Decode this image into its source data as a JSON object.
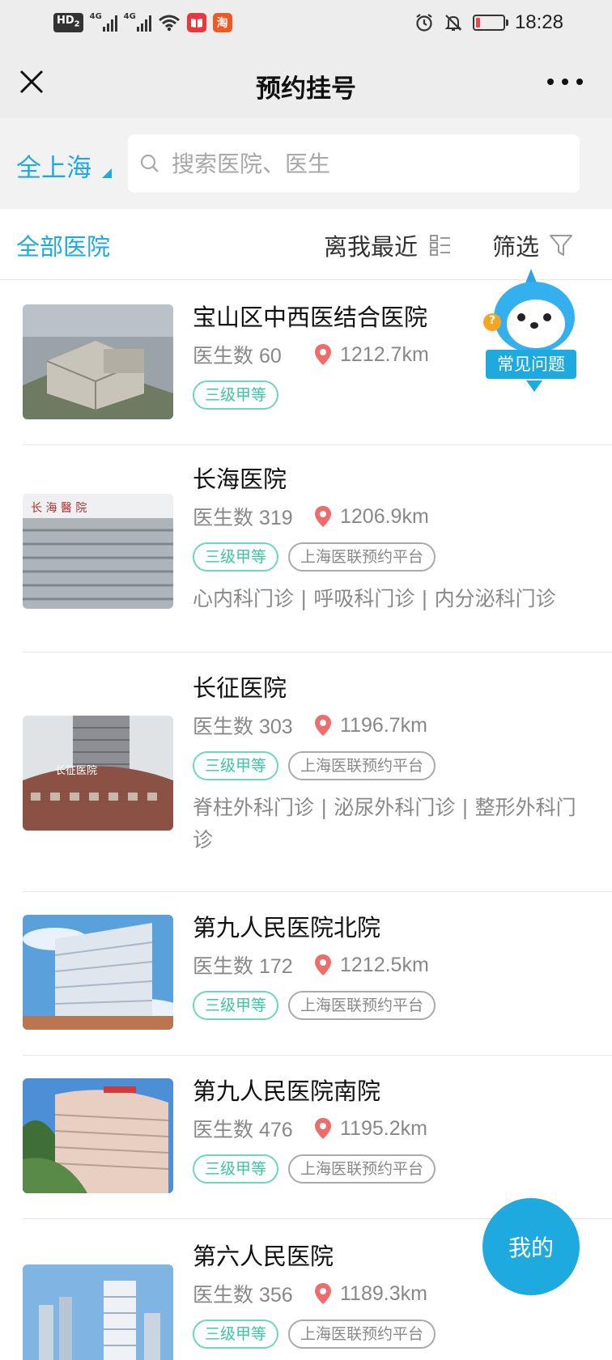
{
  "status_bar": {
    "hd": "HD",
    "hd_sub": "2",
    "net1": "4G",
    "net2": "4G",
    "app1_glyph": "",
    "app2_glyph": "淘",
    "time": "18:28",
    "battery_level": 0.15,
    "icons": [
      "hd-icon",
      "signal-icon",
      "signal-icon",
      "wifi-icon",
      "reader-app-icon",
      "taobao-app-icon",
      "alarm-icon",
      "mute-icon",
      "battery-icon"
    ]
  },
  "nav": {
    "title": "预约挂号",
    "close_icon": "close-icon",
    "more_icon": "more-icon"
  },
  "search": {
    "city": "全上海",
    "placeholder": "搜索医院、医生"
  },
  "filters": {
    "all_hospitals": "全部医院",
    "sort_nearest": "离我最近",
    "filter": "筛选"
  },
  "hospitals": [
    {
      "name": "宝山区中西医结合医院",
      "doctor_count": "医生数 60",
      "distance": "1212.7km",
      "tags": [
        "三级甲等"
      ],
      "depts": ""
    },
    {
      "name": "长海医院",
      "doctor_count": "医生数 319",
      "distance": "1206.9km",
      "tags": [
        "三级甲等",
        "上海医联预约平台"
      ],
      "depts": "心内科门诊 | 呼吸科门诊 | 内分泌科门诊"
    },
    {
      "name": "长征医院",
      "doctor_count": "医生数 303",
      "distance": "1196.7km",
      "tags": [
        "三级甲等",
        "上海医联预约平台"
      ],
      "depts": "脊柱外科门诊 | 泌尿外科门诊 | 整形外科门诊"
    },
    {
      "name": "第九人民医院北院",
      "doctor_count": "医生数 172",
      "distance": "1212.5km",
      "tags": [
        "三级甲等",
        "上海医联预约平台"
      ],
      "depts": ""
    },
    {
      "name": "第九人民医院南院",
      "doctor_count": "医生数 476",
      "distance": "1195.2km",
      "tags": [
        "三级甲等",
        "上海医联预约平台"
      ],
      "depts": ""
    },
    {
      "name": "第六人民医院",
      "doctor_count": "医生数 356",
      "distance": "1189.3km",
      "tags": [
        "三级甲等",
        "上海医联预约平台"
      ],
      "depts": ""
    }
  ],
  "floating": {
    "faq": "常见问题",
    "faq_q": "?",
    "mine": "我的"
  },
  "colors": {
    "accent": "#1eaadf",
    "level_tag": "#3cc5a5",
    "pin": "#f06b6b",
    "text_secondary": "#888888"
  }
}
